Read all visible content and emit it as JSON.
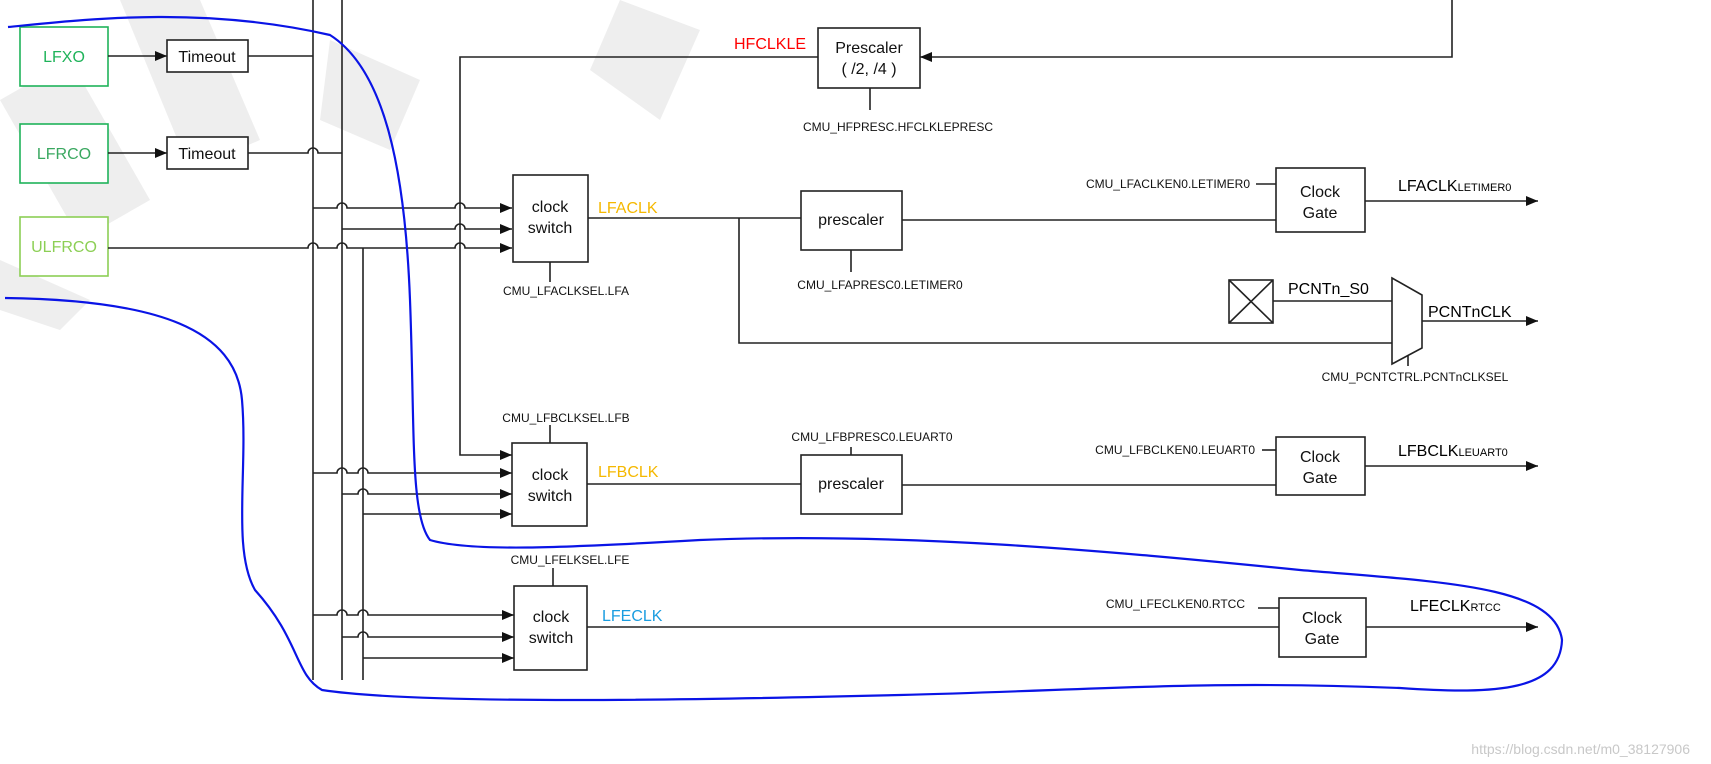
{
  "sources": [
    {
      "label": "LFXO",
      "color": "#1fb35a"
    },
    {
      "label": "LFRCO",
      "color": "#3aa860"
    },
    {
      "label": "ULFRCO",
      "color": "#8ccf55"
    }
  ],
  "timeout_label": "Timeout",
  "hfclkle": {
    "signal": "HFCLKLE",
    "signal_color": "#ff0000",
    "box_line1": "Prescaler",
    "box_line2": "( /2, /4 )",
    "register": "CMU_HFPRESC.HFCLKLEPRESC"
  },
  "clock_switch": {
    "line1": "clock",
    "line2": "switch"
  },
  "prescaler_label": "prescaler",
  "clock_gate": {
    "line1": "Clock",
    "line2": "Gate"
  },
  "lfa": {
    "signal": "LFACLK",
    "signal_color": "#f5b800",
    "sel_register": "CMU_LFACLKSEL.LFA",
    "presc_register": "CMU_LFAPRESC0.LETIMER0",
    "en_register": "CMU_LFACLKEN0.LETIMER0",
    "output": "LFACLK",
    "output_sub": "LETIMER0"
  },
  "pcnt": {
    "pin": "PCNTn_S0",
    "output": "PCNTnCLK",
    "sel_register": "CMU_PCNTCTRL.PCNTnCLKSEL"
  },
  "lfb": {
    "signal": "LFBCLK",
    "signal_color": "#f5b800",
    "sel_register": "CMU_LFBCLKSEL.LFB",
    "presc_register": "CMU_LFBPRESC0.LEUART0",
    "en_register": "CMU_LFBCLKEN0.LEUART0",
    "output": "LFBCLK",
    "output_sub": "LEUART0"
  },
  "lfe": {
    "signal": "LFECLK",
    "signal_color": "#1a9de0",
    "sel_register": "CMU_LFELKSEL.LFE",
    "en_register": "CMU_LFECLKEN0.RTCC",
    "output": "LFECLK",
    "output_sub": "RTCC"
  },
  "annotation_color": "#0a14e6",
  "watermark": "https://blog.csdn.net/m0_38127906"
}
